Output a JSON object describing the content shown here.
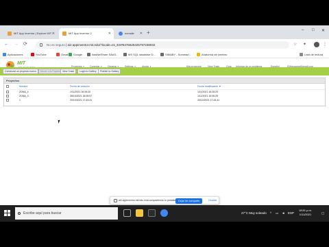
{
  "tabs": [
    {
      "title": "MIT App Inventor | Explore MIT ...",
      "active": false
    },
    {
      "title": "MIT App Inventor 2",
      "active": true
    },
    {
      "title": "ecmaile",
      "active": false
    }
  ],
  "newtab_glyph": "+",
  "window_controls": [
    "–",
    "□",
    "✕"
  ],
  "address": {
    "not_secure": "No es seguro",
    "url": "ai2.appinventor.mit.edu/?locale=es_ES#5476625425797238032"
  },
  "nav": {
    "back": "←",
    "forward": "→",
    "reload": "⟳"
  },
  "reading_list": "Lista de lectura",
  "bookmarks": [
    "Aplicaciones",
    "YouTube",
    "Gmail",
    "Google",
    "IkasNetTeam SAAS...",
    "MS SQL database D...",
    "SIMABY - Summari...",
    "Anatomía de cerebro"
  ],
  "app": {
    "brand": "MIT",
    "brand_sub": "APP INVENTOR",
    "menus": [
      "Proyectos",
      "Conectar",
      "Generar",
      "Settings",
      "Ayuda"
    ],
    "right_links": [
      "Mis proyectos",
      "View Trash",
      "Guía",
      "Informar de un problema",
      "Español",
      "ID4twoapps@gmail.com"
    ]
  },
  "toolbar": {
    "buttons": [
      "Comenzar un proyecto nuevo",
      "Mover a la Papelera",
      "View Trash",
      "Login to Gallery",
      "Publish to Gallery"
    ],
    "disabled_index": 1
  },
  "projects": {
    "title": "Proyectos",
    "columns": [
      "Nombre",
      "Fecha de creación",
      "Fecha modificación ▼"
    ],
    "rows": [
      {
        "name": "ZONA_4",
        "created": "1/11/2021 16:26:20",
        "modified": "1/11/2021 16:26:20"
      },
      {
        "name": "ZONA_3",
        "created": "28/10/2021 18:05:07",
        "modified": "1/11/2021 15:06:25"
      },
      {
        "name": "1",
        "created": "20/10/2021 17:43:41",
        "modified": "20/10/2021 17:43:41"
      }
    ]
  },
  "share_bar": {
    "message": "ai2.appinventor.mit.edu está compartiendo tu pantalla.",
    "stop": "Dejar de compartir",
    "hide": "Ocultar"
  },
  "taskbar": {
    "search_placeholder": "Escribe aquí para buscar",
    "weather": "27°C Muy soleado",
    "lang": "ESP",
    "time": "18:51 p.m.",
    "date": "1/11/2021"
  },
  "colors": {
    "toolbar": "#a5cf47",
    "brand": "#7cae3d",
    "link": "#2a66c2",
    "stop_button": "#1a73e8"
  }
}
